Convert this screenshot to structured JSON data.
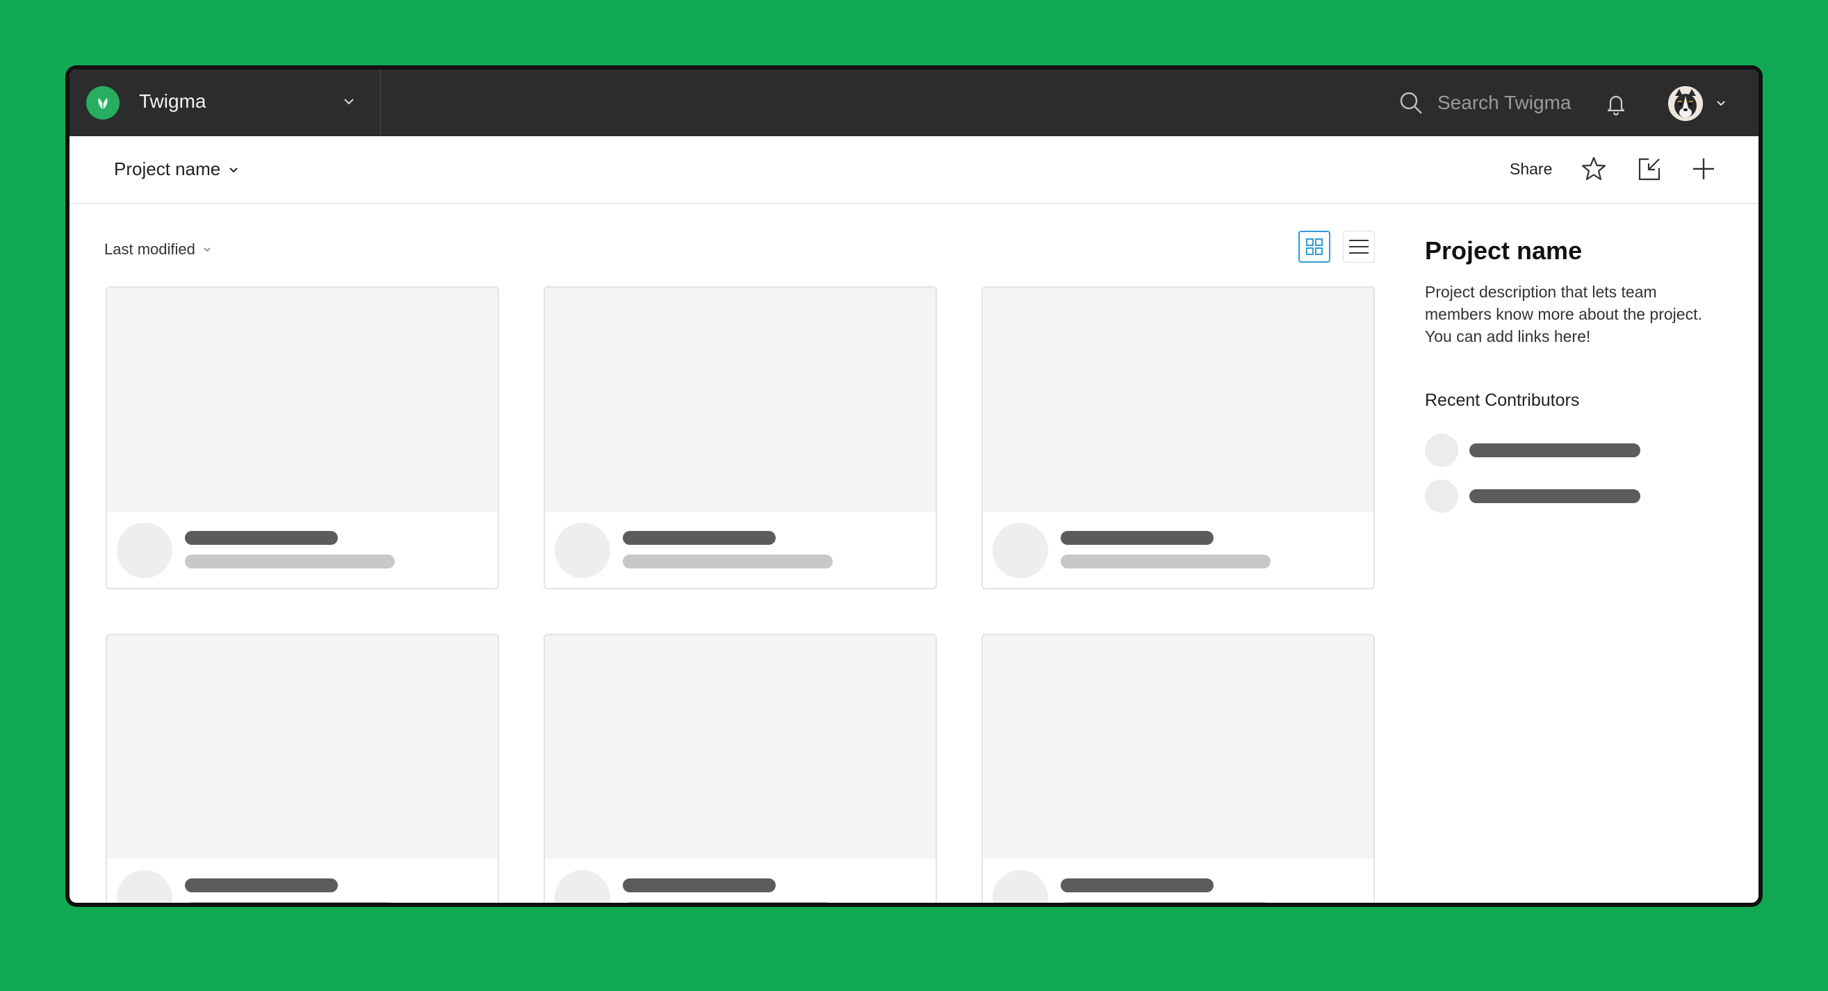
{
  "colors": {
    "background": "#12a954",
    "topbar": "#2c2c2c",
    "accent": "#2d9cdb",
    "logo": "#27ae60"
  },
  "topbar": {
    "team_name": "Twigma",
    "search_placeholder": "Search Twigma",
    "icons": [
      "plant-logo-icon",
      "chevron-down-icon",
      "search-icon",
      "bell-icon",
      "avatar",
      "chevron-down-icon"
    ]
  },
  "header": {
    "project_name": "Project name",
    "share_label": "Share",
    "icons": [
      "star-icon",
      "import-icon",
      "plus-icon"
    ]
  },
  "toolbar": {
    "sort_label": "Last modified",
    "view_modes": [
      "grid-view-icon",
      "list-view-icon"
    ],
    "active_view": "grid"
  },
  "sidebar": {
    "title": "Project name",
    "description": "Project description that lets team members know more about the project. You can add links here!",
    "contributors_heading": "Recent Contributors"
  }
}
